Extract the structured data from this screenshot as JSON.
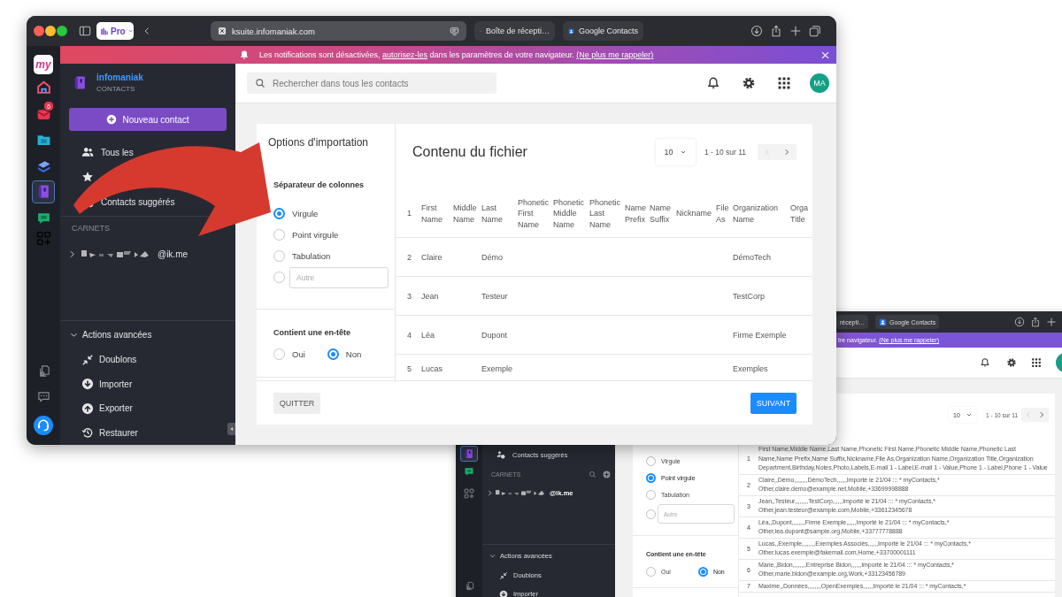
{
  "front_window": {
    "browser": {
      "pro_badge": "Pro",
      "address": "ksuite.infomaniak.com",
      "tabs": [
        {
          "label": "Boîte de récepti…",
          "selected": false
        },
        {
          "label": "Google Contacts",
          "selected": false
        }
      ]
    },
    "banner": [
      {
        "kind": "text",
        "text": "Les notifications sont désactivées, "
      },
      {
        "kind": "link",
        "text": "autorisez-les"
      },
      {
        "kind": "text",
        "text": " dans les paramètres de votre navigateur. "
      },
      {
        "kind": "link",
        "text": "(Ne plus me rappeler)"
      }
    ],
    "rail": {
      "logo": "my",
      "apps": [
        {
          "selected": false
        },
        {
          "selected": false,
          "badge": "6"
        },
        {
          "selected": false
        },
        {
          "selected": false
        },
        {
          "selected": true
        },
        {
          "selected": false
        }
      ]
    },
    "sidebar": {
      "brand": "infomaniak",
      "product": "CONTACTS",
      "new_button": "Nouveau contact",
      "nav": [
        {
          "kind": "people",
          "label": "Tous les"
        },
        {
          "kind": "star"
        },
        {
          "kind": "suggest",
          "label": "Contacts suggérés"
        }
      ],
      "section_title": "CARNETS",
      "account": {
        "suffix": "@ik.me",
        "expanded": false
      },
      "advanced": {
        "title": "Actions avancées",
        "expanded": true,
        "items": [
          {
            "kind": "merge",
            "label": "Doublons"
          },
          {
            "kind": "import",
            "label": "Importer"
          },
          {
            "kind": "export",
            "label": "Exporter"
          },
          {
            "kind": "restore",
            "label": "Restaurer"
          }
        ]
      }
    },
    "header": {
      "search_placeholder": "Rechercher dans tous les contacts",
      "avatar": "MA"
    },
    "options": {
      "title": "Options d'importation",
      "separator_label": "Séparateur de colonnes",
      "separators": [
        {
          "kind": "option",
          "label": "Virgule",
          "selected": true
        },
        {
          "kind": "option",
          "label": "Point virgule",
          "selected": false
        },
        {
          "kind": "option",
          "label": "Tabulation",
          "selected": false
        },
        {
          "kind": "custom",
          "placeholder": "Autre",
          "selected": false
        }
      ],
      "header_label": "Contient une en-tête",
      "header_options": [
        {
          "label": "Oui",
          "selected": false
        },
        {
          "label": "Non",
          "selected": true
        }
      ],
      "quit_button": "QUITTER"
    },
    "file": {
      "title": "Contenu du fichier",
      "page_size": "10",
      "range": "1 - 10 sur 11",
      "prev_disabled": true,
      "next_disabled": false,
      "next_button": "SUIVANT",
      "table": {
        "number": "1",
        "columns": [
          "First Name",
          "Middle Name",
          "Last Name",
          "Phonetic First Name",
          "Phonetic Middle Name",
          "Phonetic Last Name",
          "Name Prefix",
          "Name Suffix",
          "Nickname",
          "File As",
          "Organization Name",
          "Orga Title"
        ],
        "rows": [
          {
            "number": "2",
            "first_name": "Claire",
            "last_name": "Démo",
            "organization_name": "DémoTech"
          },
          {
            "number": "3",
            "first_name": "Jean",
            "last_name": "Testeur",
            "organization_name": "TestCorp"
          },
          {
            "number": "4",
            "first_name": "Léa",
            "last_name": "Dupont",
            "organization_name": "Firme Exemple"
          },
          {
            "number": "5",
            "first_name": "Lucas",
            "last_name": "Exemple",
            "organization_name": "Exemples"
          }
        ]
      }
    }
  },
  "back_window": {
    "tabs": [
      {
        "label": "récepti…",
        "selected": false
      },
      {
        "label": "Google Contacts",
        "selected": false
      }
    ],
    "banner": [
      {
        "kind": "text",
        "text": "tre navigateur. "
      },
      {
        "kind": "link",
        "text": "(Ne plus me rappeler)"
      }
    ],
    "rail": {
      "apps": [
        {
          "selected": true
        },
        {
          "selected": false
        }
      ]
    },
    "sidebar": {
      "nav": [
        {
          "kind": "suggest",
          "label": "Contacts suggérés"
        }
      ],
      "section_title": "CARNETS",
      "account": {
        "suffix": "@ik.me",
        "expanded": false
      },
      "advanced": {
        "title": "Actions avancées",
        "expanded": true,
        "items": [
          {
            "kind": "merge",
            "label": "Doublons"
          },
          {
            "kind": "import",
            "label": "Importer"
          }
        ]
      }
    },
    "options": {
      "separators": [
        {
          "kind": "option",
          "label": "Virgule",
          "selected": false
        },
        {
          "kind": "option",
          "label": "Point virgule",
          "selected": true
        },
        {
          "kind": "option",
          "label": "Tabulation",
          "selected": false
        },
        {
          "kind": "custom",
          "placeholder": "Autre",
          "selected": false
        }
      ],
      "header_label": "Contient une en-tête",
      "header_options": [
        {
          "label": "Oui",
          "selected": false
        },
        {
          "label": "Non",
          "selected": true
        }
      ]
    },
    "file": {
      "page_size": "10",
      "range": "1 - 10 sur 11",
      "prev_disabled": true,
      "next_disabled": false,
      "rows": [
        {
          "number": "1",
          "text": "First Name,Middle Name,Last Name,Phonetic First Name,Phonetic Middle Name,Phonetic Last Name,Name Prefix,Name Suffix,Nickname,File As,Organization Name,Organization Title,Organization Department,Birthday,Notes,Photo,Labels,E-mail 1 - Label,E-mail 1 - Value,Phone 1 - Label,Phone 1 - Value"
        },
        {
          "number": "2",
          "text": "Claire,,Démo,,,,,,,,DémoTech,,,,,,Importé le 21/04 ::: * myContacts,* Other,claire.demo@example.net,Mobile,+33699998888"
        },
        {
          "number": "3",
          "text": "Jean,,Testeur,,,,,,,,TestCorp,,,,,,Importé le 21/04 ::: * myContacts,* Other,jean.testeur@example.com,Mobile,+33612345678"
        },
        {
          "number": "4",
          "text": "Léa,,Dupont,,,,,,,,Firme Exemple,,,,,,Importé le 21/04 ::: * myContacts,* Other,lea.dupont@sample.org,Mobile,+33777778888"
        },
        {
          "number": "5",
          "text": "Lucas,,Exemple,,,,,,,,Exemples Associés,,,,,,Importé le 21/04 ::: * myContacts,* Other,lucas.exemple@fakemail.com,Home,+33700001111"
        },
        {
          "number": "6",
          "text": "Marie,,Bidon,,,,,,,,Entreprise Bidon,,,,,,Importé le 21/04 ::: * myContacts,* Other,marie.bidon@example.org,Work,+33123456789"
        },
        {
          "number": "7",
          "text": "Maxime,,Données,,,,,,,,OpenExemples,,,,,,Importé le 21/04 ::: * myContacts,*"
        }
      ]
    }
  }
}
